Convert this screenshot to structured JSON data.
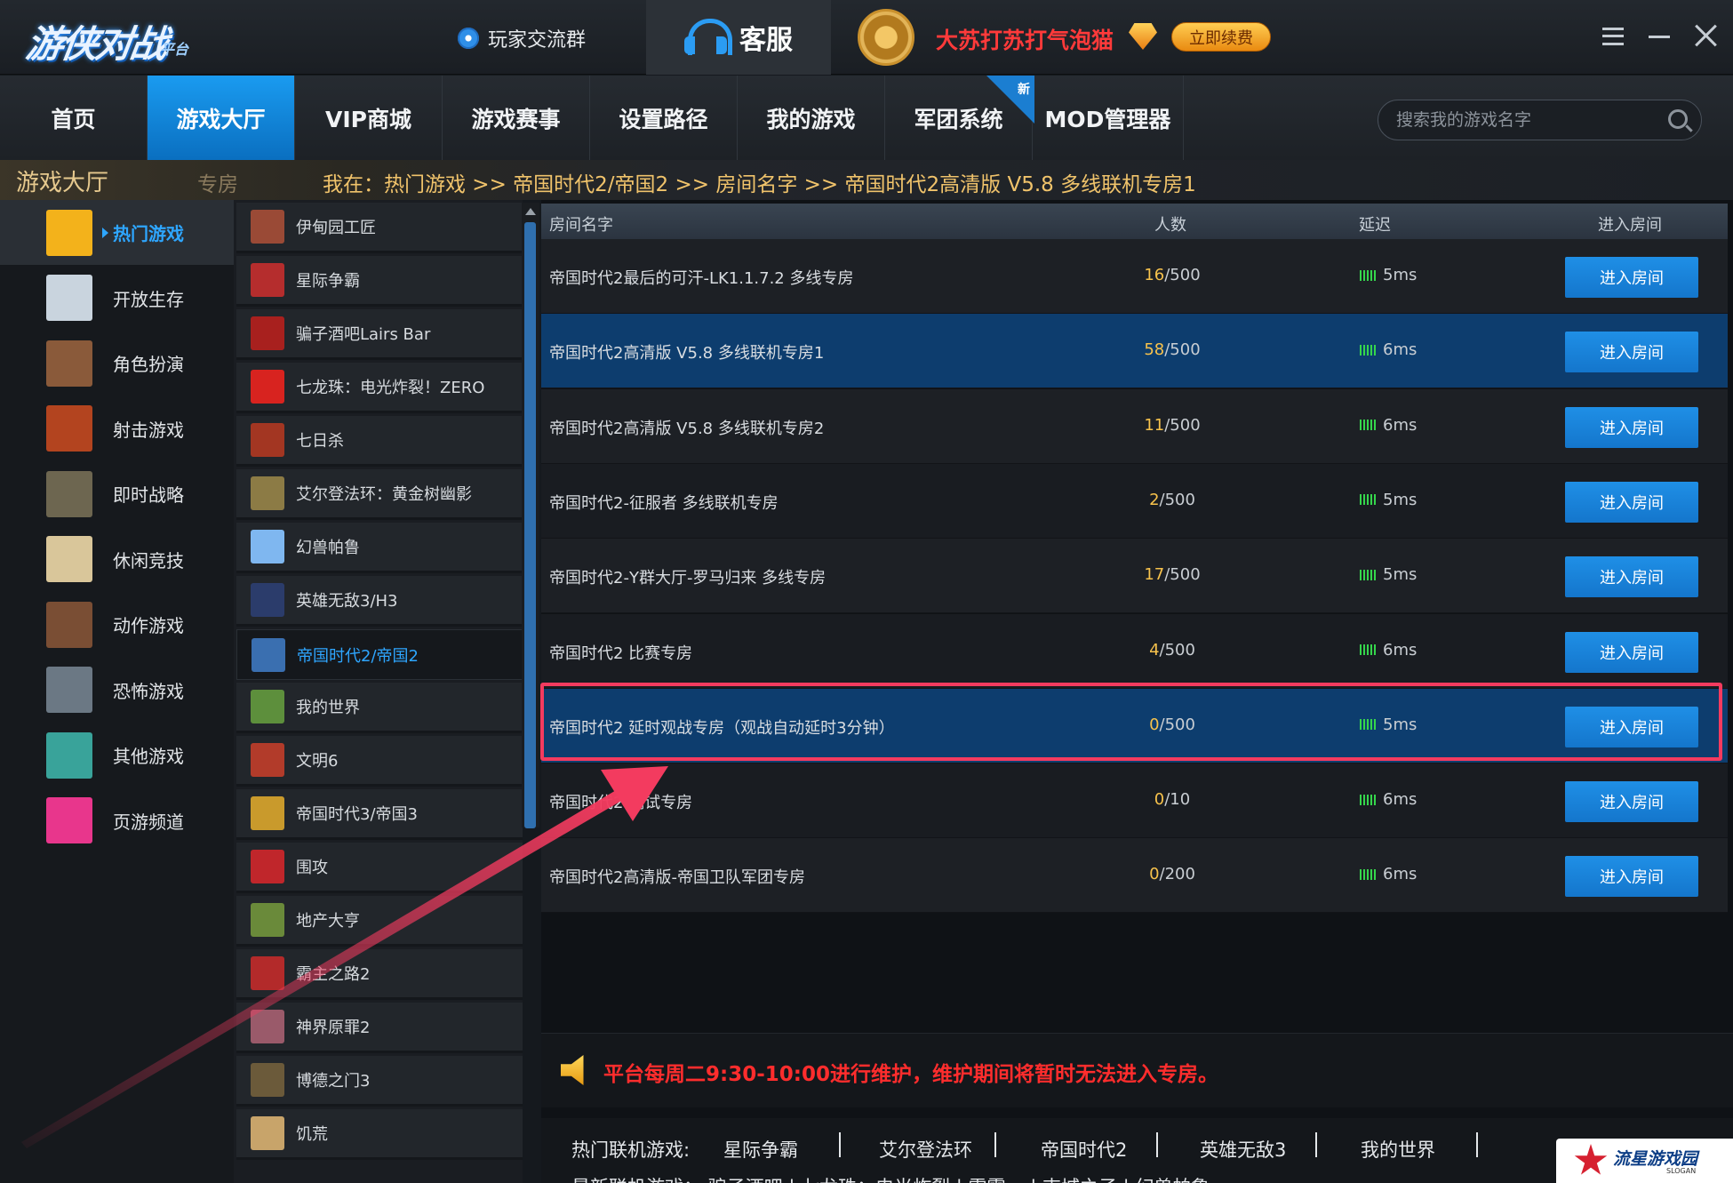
{
  "titlebar": {
    "logo_text": "游侠对战",
    "logo_sub": "平台",
    "player_group": "玩家交流群",
    "service": "客服",
    "username": "大苏打苏打气泡猫",
    "renew": "立即续费"
  },
  "nav": {
    "items": [
      "首页",
      "游戏大厅",
      "VIP商城",
      "游戏赛事",
      "设置路径",
      "我的游戏",
      "军团系统",
      "MOD管理器"
    ],
    "active_index": 1,
    "new_badge": "新",
    "search_placeholder": "搜索我的游戏名字"
  },
  "crumb": {
    "hall": "游戏大厅",
    "private": "专房",
    "path": "我在：热门游戏 >> 帝国时代2/帝国2 >> 房间名字 >> 帝国时代2高清版 V5.8 多线联机专房1"
  },
  "categories": [
    {
      "label": "热门游戏",
      "icon": "hot-icon",
      "color": "#f3b21b"
    },
    {
      "label": "开放生存",
      "icon": "axe-icon",
      "color": "#c9d4de"
    },
    {
      "label": "角色扮演",
      "icon": "warrior-icon",
      "color": "#8a5a3a"
    },
    {
      "label": "射击游戏",
      "icon": "bullet-icon",
      "color": "#b3441f"
    },
    {
      "label": "即时战略",
      "icon": "soldier-icon",
      "color": "#6d6650"
    },
    {
      "label": "休闲竞技",
      "icon": "chess-knight-icon",
      "color": "#d9c69a"
    },
    {
      "label": "动作游戏",
      "icon": "hero-icon",
      "color": "#7a4e34"
    },
    {
      "label": "恐怖游戏",
      "icon": "ghost-icon",
      "color": "#6b7884"
    },
    {
      "label": "其他游戏",
      "icon": "monitor-icon",
      "color": "#39a39a"
    },
    {
      "label": "页游频道",
      "icon": "page-icon",
      "color": "#e8368c"
    }
  ],
  "games": [
    {
      "label": "伊甸园工匠",
      "color": "#9a4a36"
    },
    {
      "label": "星际争霸",
      "color": "#b52d2d"
    },
    {
      "label": "骗子酒吧Lairs Bar",
      "color": "#a8201e"
    },
    {
      "label": "七龙珠：电光炸裂！ZERO",
      "color": "#d8231f"
    },
    {
      "label": "七日杀",
      "color": "#a33622"
    },
    {
      "label": "艾尔登法环：黄金树幽影",
      "color": "#8c7b45"
    },
    {
      "label": "幻兽帕鲁",
      "color": "#7fb7f0"
    },
    {
      "label": "英雄无敌3/H3",
      "color": "#2b3c6b"
    },
    {
      "label": "帝国时代2/帝国2",
      "color": "#3a6fb0"
    },
    {
      "label": "我的世界",
      "color": "#5d8f3c"
    },
    {
      "label": "文明6",
      "color": "#b23b2a"
    },
    {
      "label": "帝国时代3/帝国3",
      "color": "#c99a2c"
    },
    {
      "label": "围攻",
      "color": "#c0262b"
    },
    {
      "label": "地产大亨",
      "color": "#6a8a3a"
    },
    {
      "label": "霸主之路2",
      "color": "#b32a2a"
    },
    {
      "label": "神界原罪2",
      "color": "#9a5a6a"
    },
    {
      "label": "博德之门3",
      "color": "#6b5a3a"
    },
    {
      "label": "饥荒",
      "color": "#c8a46a"
    }
  ],
  "game_active_index": 8,
  "table": {
    "headers": {
      "name": "房间名字",
      "count": "人数",
      "latency": "延迟",
      "enter": "进入房间"
    },
    "rooms": [
      {
        "name": "帝国时代2最后的可汗-LK1.1.7.2 多线专房",
        "current": "16",
        "max": "/500",
        "latency": "5ms",
        "enter": "进入房间"
      },
      {
        "name": "帝国时代2高清版 V5.8 多线联机专房1",
        "current": "58",
        "max": "/500",
        "latency": "6ms",
        "enter": "进入房间"
      },
      {
        "name": "帝国时代2高清版 V5.8 多线联机专房2",
        "current": "11",
        "max": "/500",
        "latency": "6ms",
        "enter": "进入房间"
      },
      {
        "name": "帝国时代2-征服者 多线联机专房",
        "current": "2",
        "max": "/500",
        "latency": "5ms",
        "enter": "进入房间"
      },
      {
        "name": "帝国时代2-Y群大厅-罗马归来 多线专房",
        "current": "17",
        "max": "/500",
        "latency": "5ms",
        "enter": "进入房间"
      },
      {
        "name": "帝国时代2 比赛专房",
        "current": "4",
        "max": "/500",
        "latency": "6ms",
        "enter": "进入房间"
      },
      {
        "name": "帝国时代2 延时观战专房（观战自动延时3分钟）",
        "current": "0",
        "max": "/500",
        "latency": "5ms",
        "enter": "进入房间"
      },
      {
        "name": "帝国时代2 测试专房",
        "current": "0",
        "max": "/10",
        "latency": "6ms",
        "enter": "进入房间"
      },
      {
        "name": "帝国时代2高清版-帝国卫队军团专房",
        "current": "0",
        "max": "/200",
        "latency": "6ms",
        "enter": "进入房间"
      }
    ],
    "selected_indices": [
      1,
      6
    ]
  },
  "notice": "平台每周二9:30-10:00进行维护，维护期间将暂时无法进入专房。",
  "hot": {
    "label": "热门联机游戏:",
    "links": [
      "星际争霸",
      "艾尔登法环",
      "帝国时代2",
      "英雄无敌3",
      "我的世界"
    ],
    "row2": "最新联机游戏：  骗子酒吧  |  七龙珠：电光炸裂  |  雷霆一   |  吉城之子  |  幻兽帕鲁"
  },
  "watermark": {
    "text": "流星游戏园",
    "sub": "SLOGAN"
  },
  "colors": {
    "accent": "#1a9bf0",
    "highlight": "#f33b5f",
    "notice": "#ff2d2d",
    "selected_row": "#0d3d6e"
  }
}
